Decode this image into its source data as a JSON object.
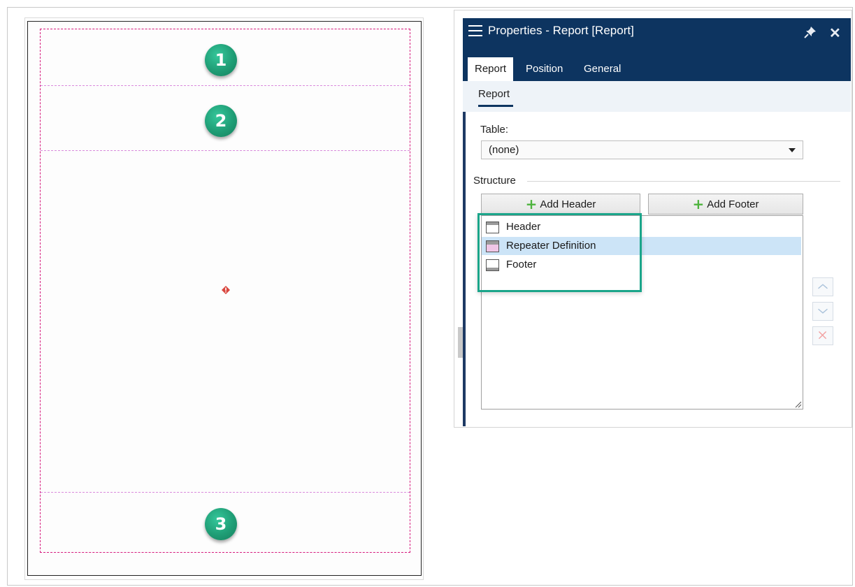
{
  "report_preview": {
    "sections": [
      {
        "label": "1"
      },
      {
        "label": "2"
      },
      {
        "label": "3"
      }
    ],
    "colors": {
      "margin": "#d6187c",
      "section_line": "#d98adc",
      "badge": "#1f9d75"
    },
    "warning_icon": "warning-icon"
  },
  "panel": {
    "title": "Properties - Report [Report]",
    "tabs": [
      {
        "label": "Report",
        "active": true
      },
      {
        "label": "Position",
        "active": false
      },
      {
        "label": "General",
        "active": false
      }
    ],
    "subtab": "Report",
    "table_label": "Table:",
    "table_value": "(none)",
    "structure_label": "Structure",
    "add_header_label": "Add Header",
    "add_footer_label": "Add Footer",
    "structure_items": [
      {
        "label": "Header",
        "icon": "header-section-icon",
        "selected": false
      },
      {
        "label": "Repeater Definition",
        "icon": "repeater-section-icon",
        "selected": true
      },
      {
        "label": "Footer",
        "icon": "footer-section-icon",
        "selected": false
      }
    ],
    "colors": {
      "titlebar": "#0d3460",
      "highlight": "#1aa58a",
      "selection": "#cce4f7"
    }
  }
}
